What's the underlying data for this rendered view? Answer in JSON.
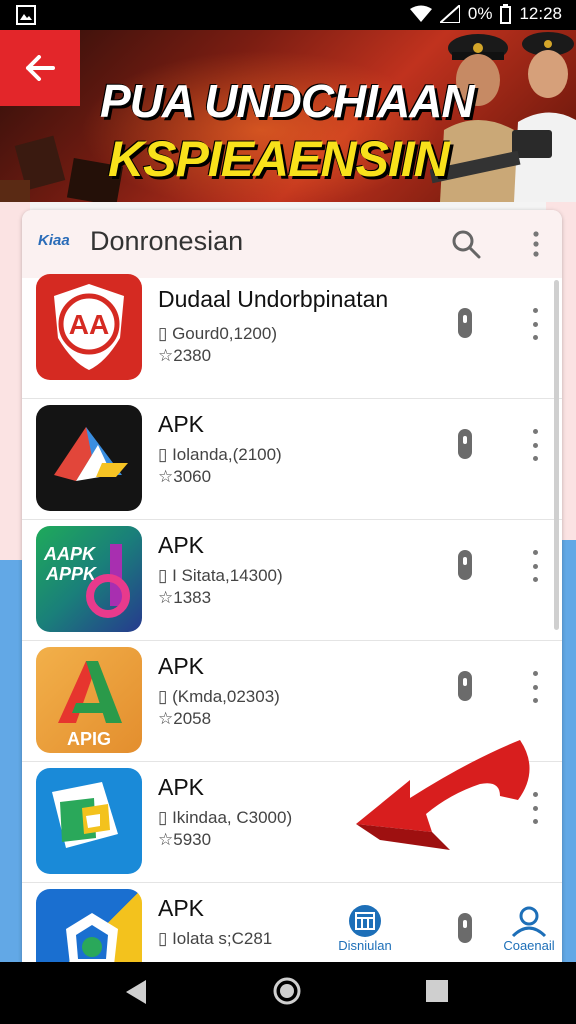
{
  "status": {
    "battery": "0%",
    "time": "12:28"
  },
  "banner": {
    "title_line1": "PUA UNDCHIAAN",
    "title_line2": "KSPIEAENSIIN"
  },
  "header": {
    "logo_text": "Kiaa",
    "title": "Donronesian"
  },
  "apps": [
    {
      "name": "Dudaal Undorbpinatan",
      "meta": "Gourd0,1200)",
      "rating": "2380",
      "icon": "red-shield-aa-icon"
    },
    {
      "name": "APK",
      "meta": "Iolanda,(2100)",
      "rating": "3060",
      "icon": "dark-arrow-a-icon"
    },
    {
      "name": "APK",
      "meta": "I Sitata,14300)",
      "rating": "1383",
      "icon": "green-apk-icon"
    },
    {
      "name": "APK",
      "meta": "(Kmda,02303)",
      "rating": "2058",
      "icon": "orange-apig-icon"
    },
    {
      "name": "APK",
      "meta": "Ikindaa, C3000)",
      "rating": "5930",
      "icon": "blue-paper-icon"
    },
    {
      "name": "APK",
      "meta": "Iolata s;C281",
      "rating": "",
      "icon": "blue-yellow-box-icon"
    }
  ],
  "tabs": {
    "left_label": "Disniulan",
    "right_label": "Coaenail"
  },
  "colors": {
    "accent_red": "#e3262a",
    "banner_yellow": "#f8e11b",
    "tab_blue": "#1d6fb8"
  }
}
